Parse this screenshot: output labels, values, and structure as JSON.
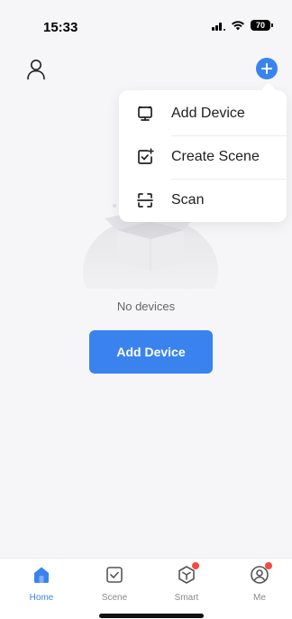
{
  "status_bar": {
    "time": "15:33",
    "battery": "70"
  },
  "header": {
    "user_icon": "user-icon",
    "add_icon": "plus-icon"
  },
  "menu": {
    "items": [
      {
        "label": "Add Device",
        "icon": "device-icon"
      },
      {
        "label": "Create Scene",
        "icon": "scene-plus-icon"
      },
      {
        "label": "Scan",
        "icon": "scan-icon"
      }
    ]
  },
  "empty_state": {
    "message": "No devices",
    "button_label": "Add Device"
  },
  "tab_bar": {
    "tabs": [
      {
        "label": "Home",
        "icon": "home-icon",
        "active": true,
        "badge": false
      },
      {
        "label": "Scene",
        "icon": "scene-icon",
        "active": false,
        "badge": false
      },
      {
        "label": "Smart",
        "icon": "smart-icon",
        "active": false,
        "badge": true
      },
      {
        "label": "Me",
        "icon": "me-icon",
        "active": false,
        "badge": true
      }
    ]
  },
  "colors": {
    "accent": "#3a83ef",
    "badge": "#f24b3f",
    "background": "#f6f6f8"
  }
}
